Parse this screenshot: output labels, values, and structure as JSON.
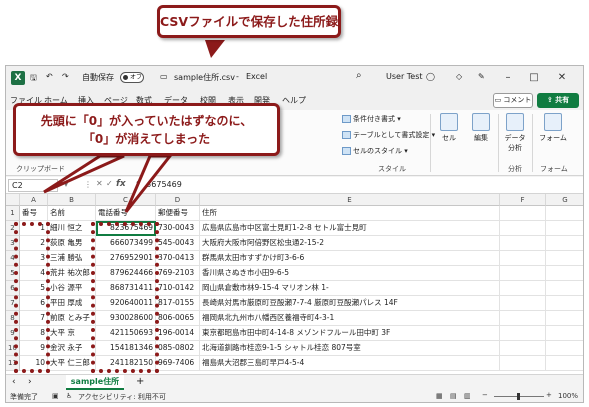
{
  "annotations": {
    "top_callout": "CSVファイルで保存した住所録",
    "mid_callout_line1": "先頭に「0」が入っていたはずなのに、",
    "mid_callout_line2": "「0」が消えてしまった"
  },
  "titlebar": {
    "autosave_label": "自動保存",
    "autosave_state": "オフ",
    "filename": "sample住所.csv",
    "separator": "-",
    "app": "Excel",
    "user": "User Test",
    "search_icon": "search-icon",
    "minimize": "–",
    "maximize": "□",
    "close": "✕"
  },
  "menu": {
    "tabs": [
      "ファイル",
      "ホーム",
      "挿入",
      "ページ",
      "数式",
      "データ",
      "校閲",
      "表示",
      "開発",
      "ヘルプ"
    ],
    "comment": "コメント",
    "share": "共有"
  },
  "ribbon": {
    "cond_format": "条件付き書式",
    "table_format": "テーブルとして書式設定",
    "cell_style": "セルのスタイル",
    "style_group": "スタイル",
    "cells": "セル",
    "edit": "編集",
    "data_analysis_1": "データ",
    "data_analysis_2": "分析",
    "analysis_group": "分析",
    "form": "フォーム",
    "form_group": "フォーム",
    "clipboard_group": "クリップボード"
  },
  "formula_bar": {
    "name_box": "C2",
    "fx": "fx",
    "value": "823675469"
  },
  "grid": {
    "columns": [
      "A",
      "B",
      "C",
      "D",
      "E",
      "F",
      "G"
    ],
    "header_row": [
      "番号",
      "名前",
      "電話番号",
      "郵便番号",
      "住所",
      "",
      ""
    ],
    "rows": [
      [
        "1",
        "細川 恒之",
        "823675469",
        "730-0043",
        "広島県広島市中区富士見町1-2-8 セトル富士見町"
      ],
      [
        "2",
        "荻原 亀男",
        "666073499",
        "545-0043",
        "大阪府大阪市阿倍野区松虫通2-15-2"
      ],
      [
        "3",
        "三浦 勝弘",
        "276952901",
        "370-0413",
        "群馬県太田市すずかけ町3-6-6"
      ],
      [
        "4",
        "荒井 祐次郎",
        "879624466",
        "769-2103",
        "香川県さぬき市小田9-6-5"
      ],
      [
        "5",
        "小谷 源平",
        "868731411",
        "710-0142",
        "岡山県倉敷市林9-15-4 マリオン林 1-"
      ],
      [
        "6",
        "平田 厚成",
        "920640011",
        "817-0155",
        "長崎県対馬市厳原町豆酘瀬7-7-4 厳原町豆酘瀬パレス 14F"
      ],
      [
        "7",
        "前原 とみ子",
        "930028600",
        "806-0065",
        "福岡県北九州市八幡西区養福寺町4-3-1"
      ],
      [
        "8",
        "大平 京",
        "421150693",
        "196-0014",
        "東京都昭島市田中町4-14-8 メゾンドフルール田中町 3F"
      ],
      [
        "9",
        "金沢 永子",
        "154181346",
        "085-0802",
        "北海道釧路市桂恋9-1-5 シャトル桂恋 807号室"
      ],
      [
        "10",
        "大平 仁三郎",
        "241182150",
        "969-7406",
        "福島県大沼郡三島町早戸4-5-4"
      ]
    ],
    "row_numbers": [
      "1",
      "2",
      "3",
      "4",
      "5",
      "6",
      "7",
      "8",
      "9",
      "10",
      "11"
    ]
  },
  "sheets": {
    "active": "sample住所",
    "add": "+",
    "nav_prev": "‹",
    "nav_next": "›"
  },
  "status": {
    "ready": "準備完了",
    "accessibility": "アクセシビリティ: 利用不可",
    "zoom": "100%"
  }
}
